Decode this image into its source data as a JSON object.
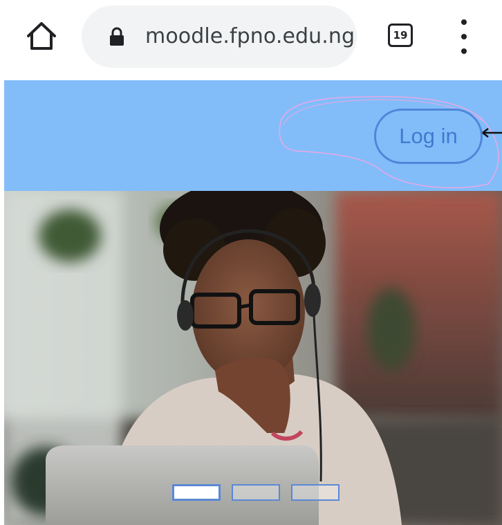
{
  "browser": {
    "url": "moodle.fpno.edu.ng",
    "tab_count": "19",
    "icons": [
      "home-icon",
      "lock-icon",
      "tab-switcher-icon",
      "more-vert-icon"
    ]
  },
  "header": {
    "background_color": "#82bdf9",
    "login_label": "Log in",
    "login_color": "#4f86d9"
  },
  "hero": {
    "image": "photo-woman-with-headset-at-laptop",
    "carousel": {
      "slides": 3,
      "active_index": 0
    }
  }
}
